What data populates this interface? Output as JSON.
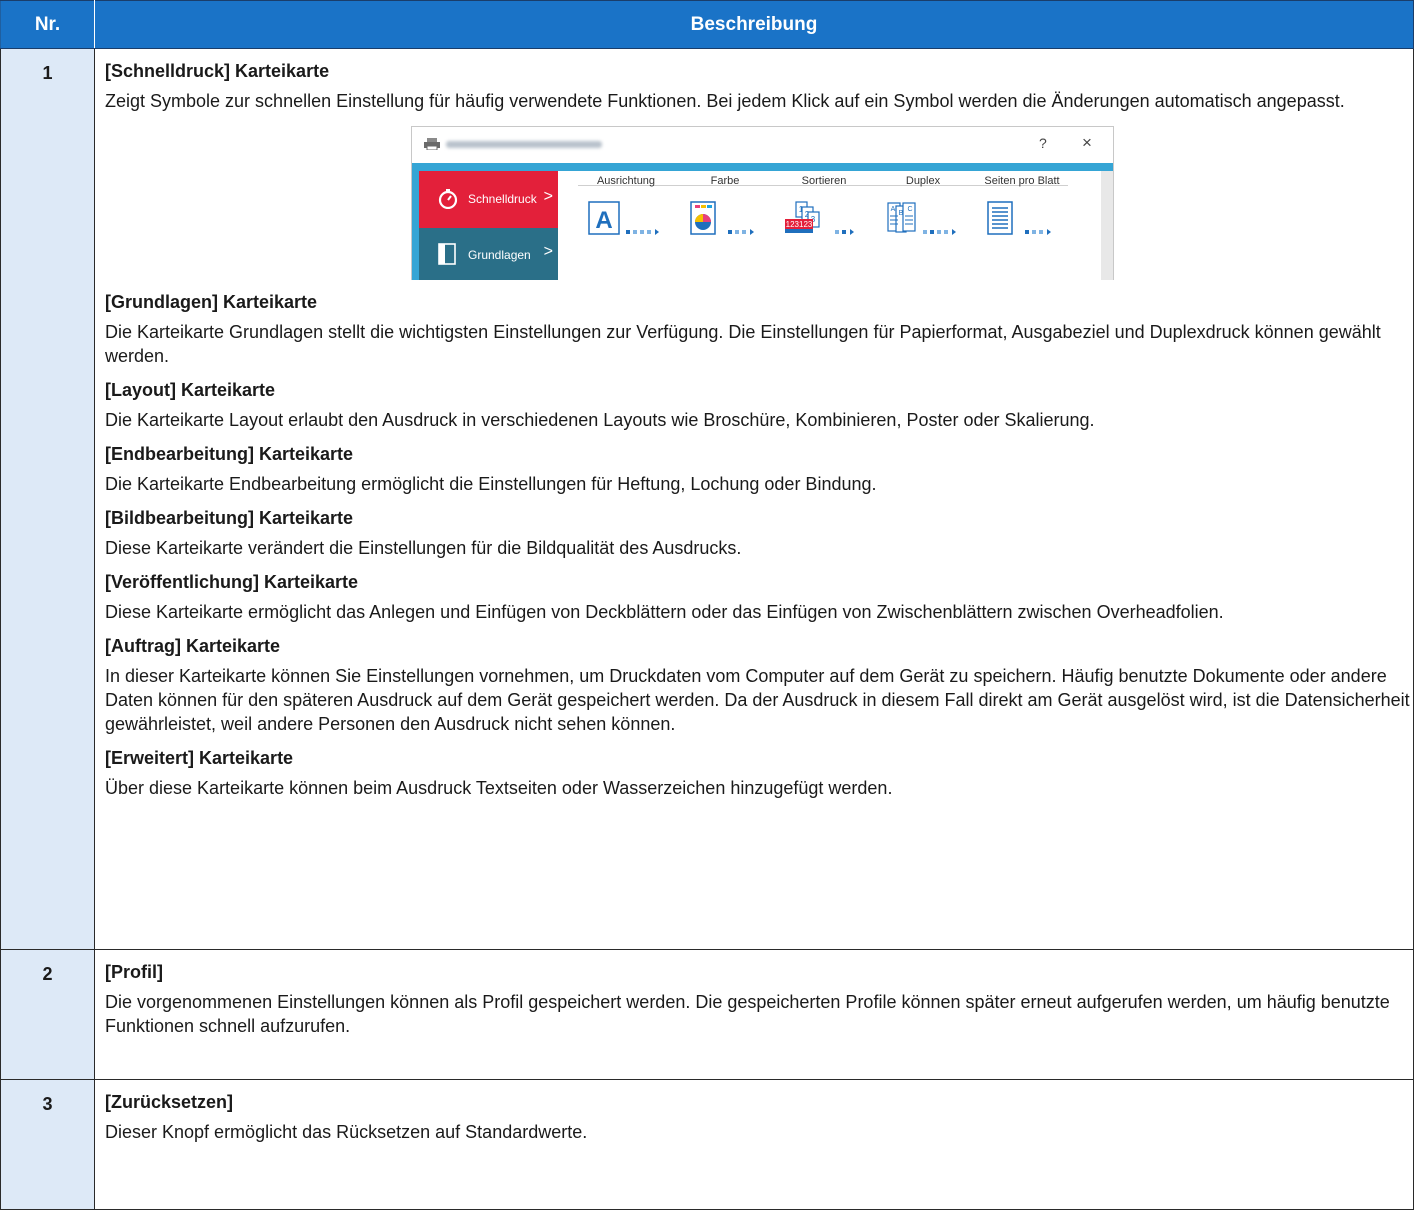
{
  "table": {
    "header": {
      "nr": "Nr.",
      "beschreibung": "Beschreibung"
    },
    "row1": {
      "num": "1",
      "tabs": [
        {
          "heading": "[Schnelldruck] Karteikarte",
          "text": "Zeigt Symbole zur schnellen Einstellung für häufig verwendete Funktionen. Bei jedem Klick auf ein Symbol werden die Änderungen automatisch angepasst."
        },
        {
          "heading": "[Grundlagen] Karteikarte",
          "text": "Die Karteikarte Grundlagen stellt die wichtigsten Einstellungen zur Verfügung. Die Einstellungen für Papierformat, Ausgabeziel und Duplexdruck können gewählt werden."
        },
        {
          "heading": "[Layout] Karteikarte",
          "text": "Die Karteikarte Layout erlaubt den Ausdruck in verschiedenen Layouts wie Broschüre, Kombinieren, Poster oder Skalierung."
        },
        {
          "heading": "[Endbearbeitung] Karteikarte",
          "text": "Die Karteikarte Endbearbeitung ermöglicht die Einstellungen für Heftung, Lochung oder Bindung."
        },
        {
          "heading": "[Bildbearbeitung] Karteikarte",
          "text": "Diese Karteikarte verändert die Einstellungen für die Bildqualität des Ausdrucks."
        },
        {
          "heading": "[Veröffentlichung] Karteikarte",
          "text": "Diese Karteikarte ermöglicht das Anlegen und Einfügen von Deckblättern oder das Einfügen von Zwischenblättern zwischen Overheadfolien."
        },
        {
          "heading": "[Auftrag] Karteikarte",
          "text": "In dieser Karteikarte können Sie Einstellungen vornehmen, um Druckdaten vom Computer auf dem Gerät zu speichern. Häufig benutzte Dokumente oder andere Daten können für den späteren Ausdruck auf dem Gerät gespeichert werden. Da der Ausdruck in diesem Fall direkt am Gerät ausgelöst wird, ist die Datensicherheit gewährleistet, weil andere Personen den Ausdruck nicht sehen können."
        },
        {
          "heading": "[Erweitert] Karteikarte",
          "text": "Über diese Karteikarte können beim Ausdruck Textseiten oder Wasserzeichen hinzugefügt werden."
        }
      ]
    },
    "row2": {
      "num": "2",
      "heading": "[Profil]",
      "text": "Die vorgenommenen Einstellungen können als Profil gespeichert werden. Die gespeicherten Profile können später erneut aufgerufen werden, um häufig benutzte Funktionen schnell aufzurufen."
    },
    "row3": {
      "num": "3",
      "heading": "[Zurücksetzen]",
      "text": "Dieser Knopf ermöglicht das Rücksetzen auf Standardwerte."
    }
  },
  "screenshot": {
    "help": "?",
    "close": "×",
    "sidebar": [
      {
        "label": "Schnelldruck",
        "icon": "stopwatch-icon",
        "color": "#e3203a"
      },
      {
        "label": "Grundlagen",
        "icon": "book-icon",
        "color": "#2a6f88"
      }
    ],
    "columns": [
      {
        "label": "Ausrichtung",
        "icon": "orientation-icon"
      },
      {
        "label": "Farbe",
        "icon": "color-icon"
      },
      {
        "label": "Sortieren",
        "icon": "collate-icon"
      },
      {
        "label": "Duplex",
        "icon": "duplex-icon"
      },
      {
        "label": "Seiten pro Blatt",
        "icon": "pages-per-sheet-icon"
      }
    ],
    "collate_icon_text": {
      "top": "1",
      "mid": "2",
      "back": "3",
      "front": "123123"
    },
    "duplex_icon_text": {
      "left": "A",
      "mid": "B",
      "right": "C"
    },
    "orientation_icon_text": "A",
    "accent_color": "#35a5d5"
  }
}
